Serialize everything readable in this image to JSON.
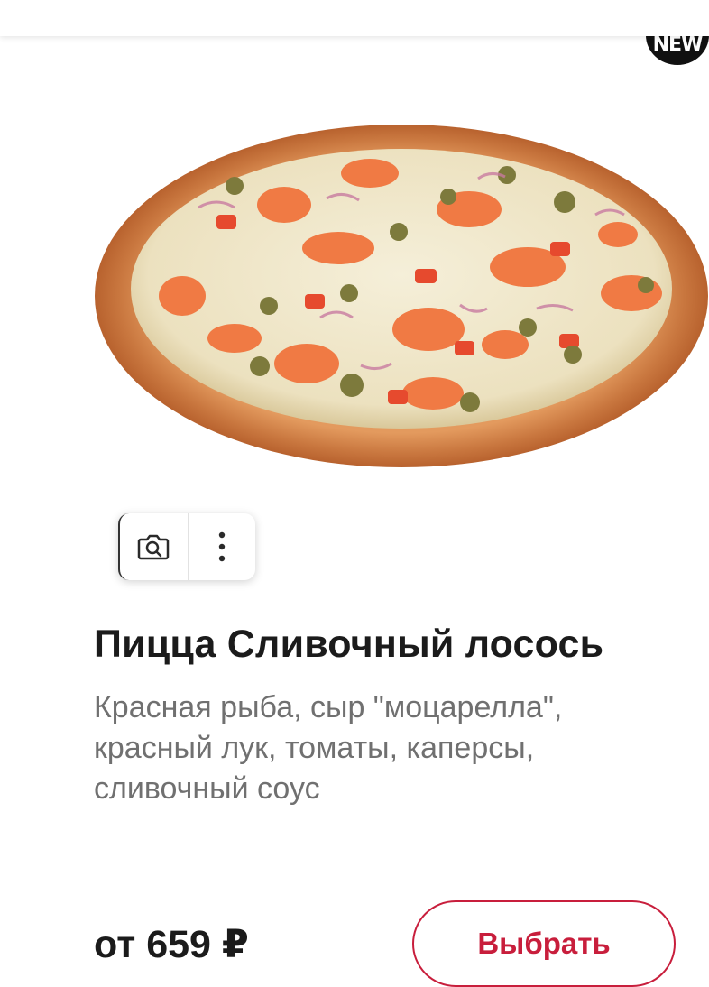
{
  "product": {
    "badge": "NEW",
    "title": "Пицца Сливочный лосось",
    "description": "Красная рыба, сыр \"моцарелла\", красный лук, томаты, каперсы, сливочный соус",
    "price": "от 659 ₽",
    "select_label": "Выбрать"
  },
  "actions": {
    "camera_icon": "camera-search-icon",
    "more_icon": "more-vertical-icon"
  },
  "colors": {
    "accent": "#c81e3c",
    "title": "#1b1b1b",
    "description": "#707070",
    "badge_bg": "#111111"
  }
}
